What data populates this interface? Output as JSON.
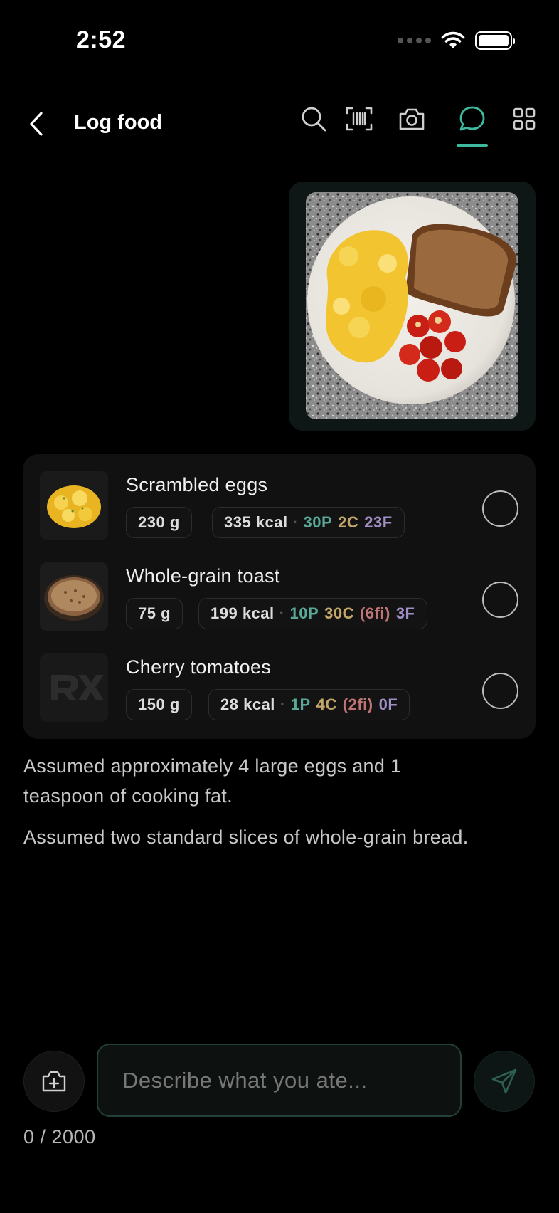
{
  "status": {
    "time": "2:52"
  },
  "header": {
    "title": "Log food",
    "tools": [
      "search-icon",
      "barcode-icon",
      "camera-icon",
      "chat-icon",
      "grid-icon"
    ],
    "active_tool": "chat-icon",
    "accent": "#3fb8a0"
  },
  "items": [
    {
      "name": "Scrambled eggs",
      "weight": "230 g",
      "kcal": "335 kcal",
      "protein": "30P",
      "carbs": "2C",
      "fiber": "",
      "fat": "23F",
      "checked": false
    },
    {
      "name": "Whole-grain toast",
      "weight": "75 g",
      "kcal": "199 kcal",
      "protein": "10P",
      "carbs": "30C",
      "fiber": "(6fi)",
      "fat": "3F",
      "checked": false
    },
    {
      "name": "Cherry tomatoes",
      "weight": "150 g",
      "kcal": "28 kcal",
      "protein": "1P",
      "carbs": "4C",
      "fiber": "(2fi)",
      "fat": "0F",
      "checked": false
    }
  ],
  "notes": [
    "Assumed approximately 4 large eggs and 1 teaspoon of cooking fat.",
    "Assumed two standard slices of whole-grain bread."
  ],
  "composer": {
    "placeholder": "Describe what you ate...",
    "value": "",
    "char_count": "0 / 2000"
  },
  "colors": {
    "protein": "#5aa898",
    "carbs": "#c4a86a",
    "fiber": "#c07476",
    "fat": "#9f8fc4"
  }
}
